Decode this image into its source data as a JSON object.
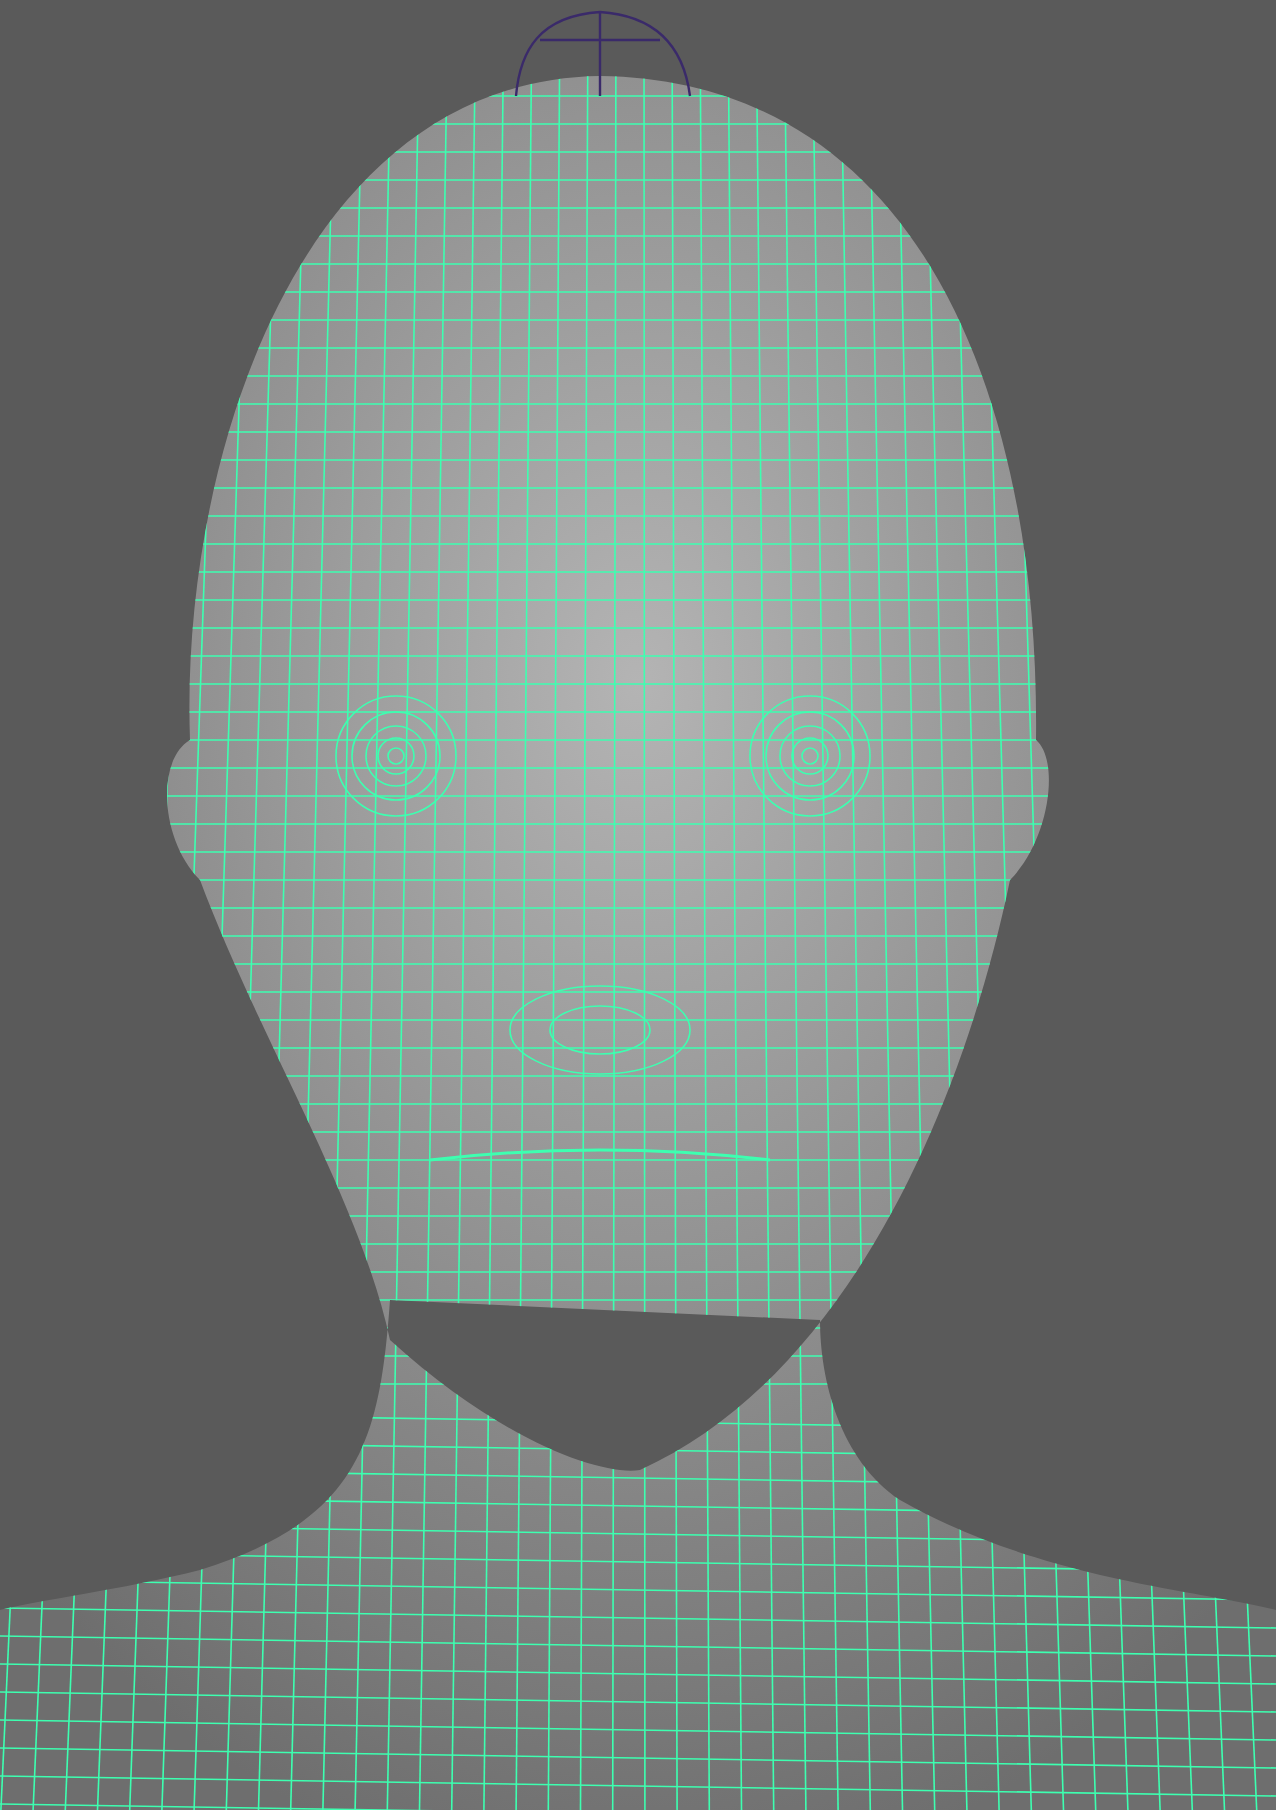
{
  "viewport": {
    "kind": "wireframe-mesh"
  }
}
